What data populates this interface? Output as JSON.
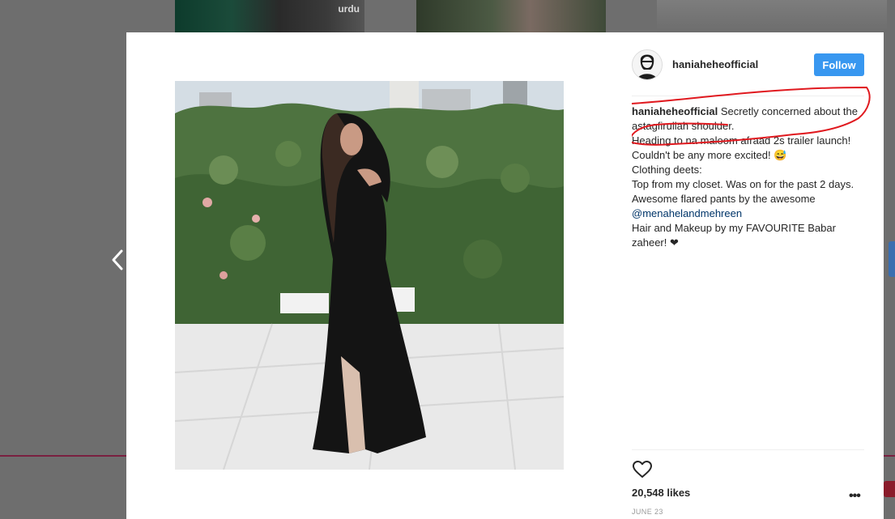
{
  "background": {
    "thumb_text": "urdu"
  },
  "post": {
    "username": "haniaheheofficial",
    "follow_label": "Follow",
    "caption_lines": [
      "Secretly concerned about the astagfirullah shoulder.",
      "Heading to na maloom afraad 2s trailer launch! Couldn't be any more excited! 😅",
      "Clothing deets:",
      "Top from my closet. Was on for the past 2 days.",
      "Awesome flared pants by the awesome",
      "@menahelandmehreen",
      "Hair and Makeup by my FAVOURITE Babar zaheer! ❤"
    ],
    "likes": "20,548 likes",
    "date": "JUNE 23",
    "more_label": "•••"
  },
  "colors": {
    "follow_button": "#3897f0",
    "mention": "#003569",
    "scribble": "#e0191f",
    "overlay": "#6e6e6e"
  },
  "icons": {
    "prev": "chevron-left-icon",
    "like": "heart-outline-icon",
    "more": "more-dots-icon"
  }
}
